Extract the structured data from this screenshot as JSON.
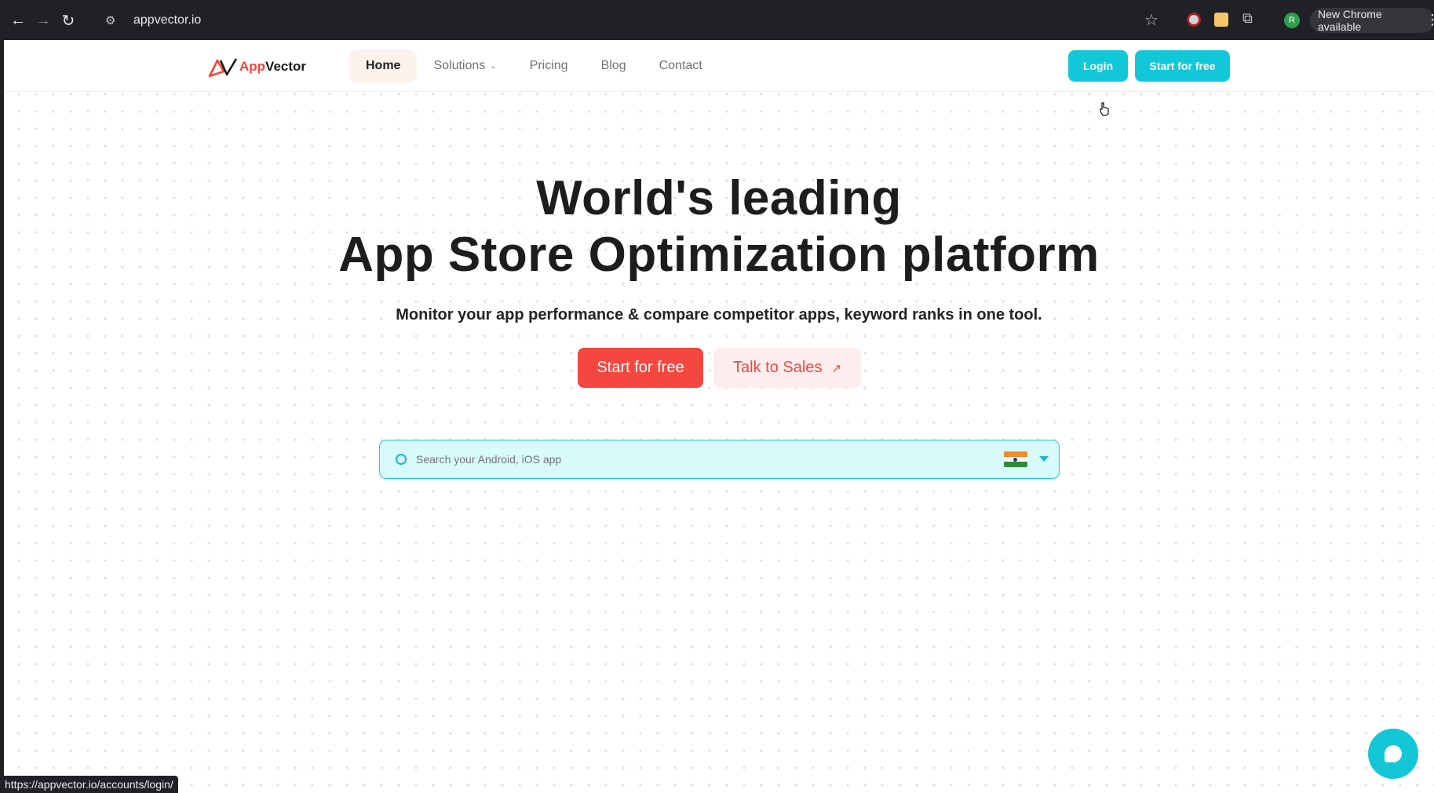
{
  "browser": {
    "url": "appvector.io",
    "update_label": "New Chrome available",
    "profile_initial": "R",
    "status_url": "https://appvector.io/accounts/login/"
  },
  "header": {
    "logo_app": "App",
    "logo_vector": "Vector",
    "nav": [
      {
        "label": "Home"
      },
      {
        "label": "Solutions"
      },
      {
        "label": "Pricing"
      },
      {
        "label": "Blog"
      },
      {
        "label": "Contact"
      }
    ],
    "login_label": "Login",
    "start_label": "Start for free"
  },
  "hero": {
    "title_line1": "World's leading",
    "title_line2": "App Store Optimization platform",
    "subtitle": "Monitor your app performance & compare competitor apps, keyword ranks in one tool.",
    "cta_primary": "Start for free",
    "cta_secondary": "Talk to Sales",
    "cta_secondary_icon": "↗"
  },
  "search": {
    "placeholder": "Search your Android, iOS app",
    "country_flag": "India"
  },
  "colors": {
    "accent_cyan": "#12c8d8",
    "brand_red": "#f4473f"
  }
}
